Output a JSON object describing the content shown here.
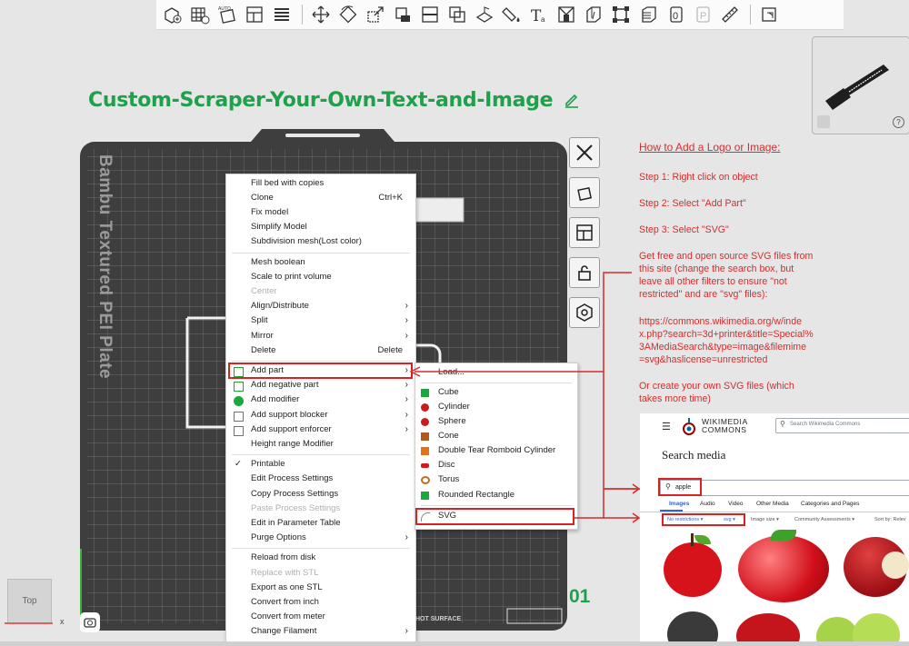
{
  "plate": {
    "title": "Custom-Scraper-Your-Own-Text-and-Image",
    "label": "Bambu Textured PEI Plate",
    "number": "01",
    "hot_surface": "HOT SURFACE"
  },
  "view": {
    "cube_label": "Top",
    "axis_x": "x"
  },
  "toolbar_icons": [
    "add-object-icon",
    "add-plate-icon",
    "auto-arrange-icon",
    "arrange-icon",
    "layers-icon",
    "move-icon",
    "rotate-icon",
    "scale-icon",
    "place-on-face-icon",
    "cut-icon",
    "boolean-icon",
    "support-paint-icon",
    "color-paint-icon",
    "text-icon",
    "assembly-icon",
    "seam-icon",
    "measure-icon",
    "slice-view-icon",
    "variable-layer-icon",
    "orient-icon",
    "plate-p-icon",
    "ruler-icon",
    "settings-icon"
  ],
  "context_menu": {
    "items": [
      {
        "label": "Fill bed with copies",
        "shortcut": "",
        "arrow": false,
        "disabled": false
      },
      {
        "label": "Clone",
        "shortcut": "Ctrl+K",
        "arrow": false,
        "disabled": false
      },
      {
        "label": "Fix model",
        "shortcut": "",
        "arrow": false,
        "disabled": false
      },
      {
        "label": "Simplify Model",
        "shortcut": "",
        "arrow": false,
        "disabled": false
      },
      {
        "label": "Subdivision mesh(Lost color)",
        "shortcut": "",
        "arrow": false,
        "disabled": false
      },
      {
        "label": "Mesh boolean",
        "shortcut": "",
        "arrow": false,
        "disabled": false
      },
      {
        "label": "Scale to print volume",
        "shortcut": "",
        "arrow": false,
        "disabled": false
      },
      {
        "label": "Center",
        "shortcut": "",
        "arrow": false,
        "disabled": true
      },
      {
        "label": "Align/Distribute",
        "shortcut": "",
        "arrow": true,
        "disabled": false
      },
      {
        "label": "Split",
        "shortcut": "",
        "arrow": true,
        "disabled": false
      },
      {
        "label": "Mirror",
        "shortcut": "",
        "arrow": true,
        "disabled": false
      },
      {
        "label": "Delete",
        "shortcut": "Delete",
        "arrow": false,
        "disabled": false
      },
      {
        "label": "Add part",
        "shortcut": "",
        "arrow": true,
        "disabled": false
      },
      {
        "label": "Add negative part",
        "shortcut": "",
        "arrow": true,
        "disabled": false
      },
      {
        "label": "Add modifier",
        "shortcut": "",
        "arrow": true,
        "disabled": false
      },
      {
        "label": "Add support blocker",
        "shortcut": "",
        "arrow": true,
        "disabled": false
      },
      {
        "label": "Add support enforcer",
        "shortcut": "",
        "arrow": true,
        "disabled": false
      },
      {
        "label": "Height range Modifier",
        "shortcut": "",
        "arrow": false,
        "disabled": false
      },
      {
        "label": "Printable",
        "shortcut": "",
        "arrow": false,
        "disabled": false
      },
      {
        "label": "Edit Process Settings",
        "shortcut": "",
        "arrow": false,
        "disabled": false
      },
      {
        "label": "Copy Process Settings",
        "shortcut": "",
        "arrow": false,
        "disabled": false
      },
      {
        "label": "Paste Process Settings",
        "shortcut": "",
        "arrow": false,
        "disabled": true
      },
      {
        "label": "Edit in Parameter Table",
        "shortcut": "",
        "arrow": false,
        "disabled": false
      },
      {
        "label": "Purge Options",
        "shortcut": "",
        "arrow": true,
        "disabled": false
      },
      {
        "label": "Reload from disk",
        "shortcut": "",
        "arrow": false,
        "disabled": false
      },
      {
        "label": "Replace with STL",
        "shortcut": "",
        "arrow": false,
        "disabled": true
      },
      {
        "label": "Export as one STL",
        "shortcut": "",
        "arrow": false,
        "disabled": false
      },
      {
        "label": "Convert from inch",
        "shortcut": "",
        "arrow": false,
        "disabled": false
      },
      {
        "label": "Convert from meter",
        "shortcut": "",
        "arrow": false,
        "disabled": false
      },
      {
        "label": "Change Filament",
        "shortcut": "",
        "arrow": true,
        "disabled": false
      }
    ],
    "checked_item": "Printable",
    "highlighted_item": "Add part"
  },
  "submenu": {
    "items": [
      {
        "label": "Load...",
        "icon": "none",
        "color": ""
      },
      {
        "label": "Cube",
        "icon": "cube-icon",
        "color": "#19a83c"
      },
      {
        "label": "Cylinder",
        "icon": "cylinder-icon",
        "color": "#c81e1e"
      },
      {
        "label": "Sphere",
        "icon": "sphere-icon",
        "color": "#c81e1e"
      },
      {
        "label": "Cone",
        "icon": "cone-icon",
        "color": "#b05a1e"
      },
      {
        "label": "Double Tear Romboid Cylinder",
        "icon": "romboid-icon",
        "color": "#e0701a"
      },
      {
        "label": "Disc",
        "icon": "disc-icon",
        "color": "#d81818"
      },
      {
        "label": "Torus",
        "icon": "torus-icon",
        "color": "#c86a1e"
      },
      {
        "label": "Rounded Rectangle",
        "icon": "rounded-rect-icon",
        "color": "#19a83c"
      },
      {
        "label": "SVG",
        "icon": "svg-icon",
        "color": "#888888"
      }
    ],
    "highlighted_item": "SVG"
  },
  "instructions": {
    "heading": "How to Add a Logo or Image:",
    "step1": "Step 1: Right click on object",
    "step2": "Step 2: Select \"Add Part\"",
    "step3": "Step 3: Select \"SVG\"",
    "source_lines": [
      "Get free and open source SVG files from",
      "this site (change the search box, but",
      "leave all other filters to ensure \"not",
      "restricted\" and are \"svg\" files):"
    ],
    "url_lines": [
      "https://commons.wikimedia.org/w/inde",
      "x.php?search=3d+printer&title=Special%",
      "3AMediaSearch&type=image&filemime",
      "=svg&haslicense=unrestricted"
    ],
    "create_lines": [
      "Or create  your own SVG files (which",
      "takes more time)"
    ]
  },
  "wikimedia": {
    "logo_line1": "WIKIMEDIA",
    "logo_line2": "COMMONS",
    "search_placeholder": "Search Wikimedia Commons",
    "page_title": "Search media",
    "query": "apple",
    "tabs": [
      "Images",
      "Audio",
      "Video",
      "Other Media",
      "Categories and Pages"
    ],
    "filter_license": "No restrictions",
    "filter_type": "svg",
    "filter_size": "Image size",
    "filter_community": "Community Assessments",
    "sort": "Sort by: Relev"
  },
  "colors": {
    "accent_green": "#1fa04a",
    "annotation_red": "#d42d2d",
    "highlight_red": "#d62222"
  }
}
